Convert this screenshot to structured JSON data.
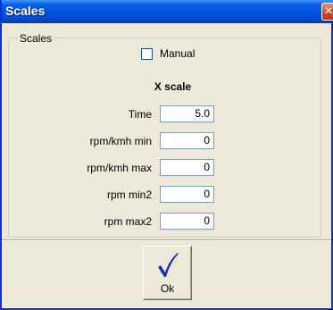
{
  "window": {
    "title": "Scales",
    "close_glyph": "✕"
  },
  "group": {
    "legend": "Scales"
  },
  "manual": {
    "label": "Manual",
    "checked": false
  },
  "xscale": {
    "title": "X scale",
    "fields": [
      {
        "label": "Time",
        "value": "5.0"
      },
      {
        "label": "rpm/kmh min",
        "value": "0"
      },
      {
        "label": "rpm/kmh max",
        "value": "0"
      },
      {
        "label": "rpm min2",
        "value": "0"
      },
      {
        "label": "rpm max2",
        "value": "0"
      }
    ]
  },
  "ok_button": {
    "label": "Ok",
    "icon": "checkmark-icon",
    "icon_color": "#1a2fb0"
  },
  "colors": {
    "titlebar": "#0053e1",
    "window_bg": "#ece9d8",
    "close": "#d4472a"
  }
}
